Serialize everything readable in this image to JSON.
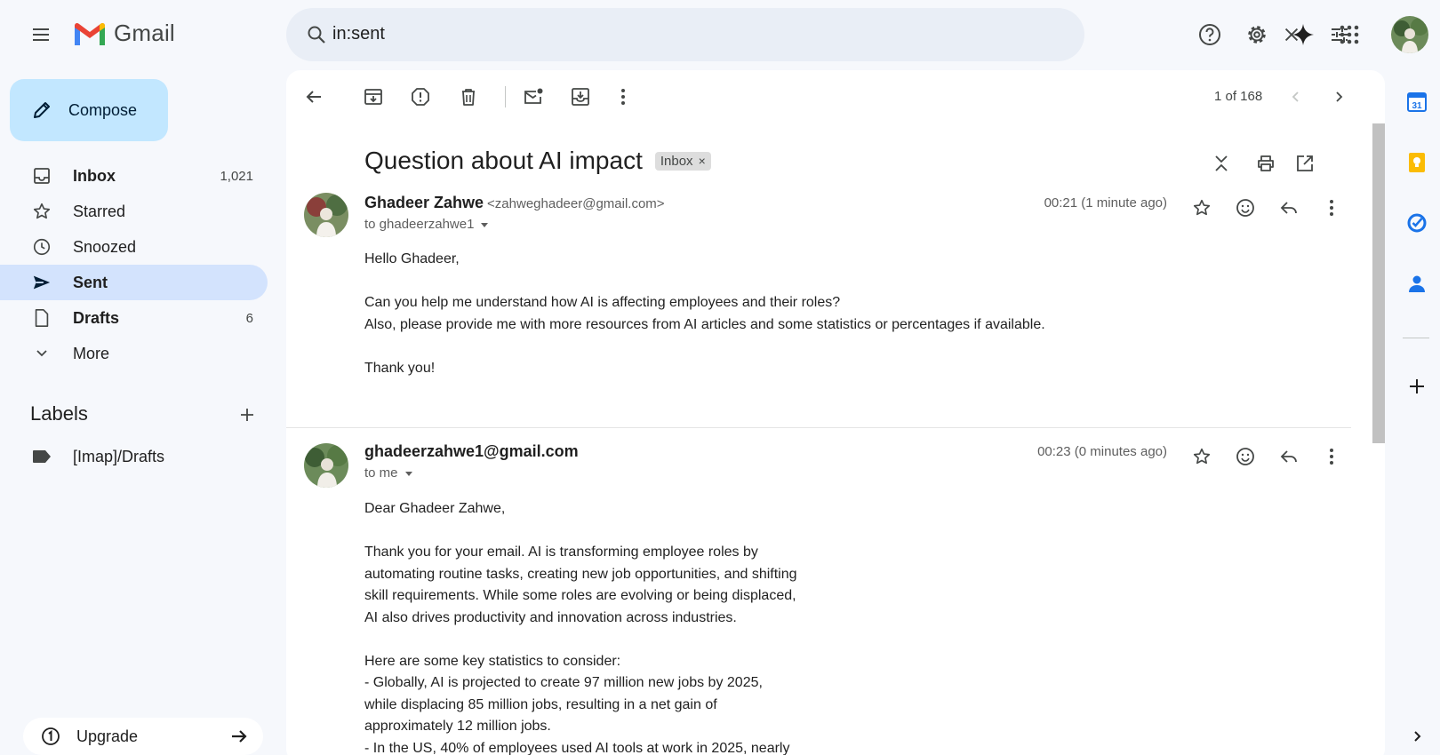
{
  "app": {
    "name": "Gmail"
  },
  "search": {
    "query": "in:sent"
  },
  "compose": {
    "label": "Compose"
  },
  "nav": [
    {
      "label": "Inbox",
      "count": "1,021"
    },
    {
      "label": "Starred",
      "count": ""
    },
    {
      "label": "Snoozed",
      "count": ""
    },
    {
      "label": "Sent",
      "count": ""
    },
    {
      "label": "Drafts",
      "count": "6"
    },
    {
      "label": "More",
      "count": ""
    }
  ],
  "labels": {
    "heading": "Labels",
    "items": [
      "[Imap]/Drafts"
    ]
  },
  "upgrade": {
    "label": "Upgrade"
  },
  "toolbar": {
    "pager": "1 of 168"
  },
  "thread": {
    "subject": "Question about AI impact",
    "chip": "Inbox",
    "chip_close": "×"
  },
  "messages": [
    {
      "sender_name": "Ghadeer Zahwe",
      "sender_email": "<zahweghadeer@gmail.com>",
      "to": "to ghadeerzahwe1",
      "time": "00:21 (1 minute ago)",
      "body": "  Hello Ghadeer,\n\nCan you help me understand how AI is affecting employees and their roles?\nAlso, please provide me with more resources from AI articles and some statistics or percentages if available.\n\nThank you!"
    },
    {
      "sender_name": "ghadeerzahwe1@gmail.com",
      "sender_email": "",
      "to": "to me",
      "time": "00:23 (0 minutes ago)",
      "body": "Dear Ghadeer Zahwe,\n\nThank you for your email. AI is transforming employee roles by\nautomating routine tasks, creating new job opportunities, and shifting\nskill requirements. While some roles are evolving or being displaced,\nAI also drives productivity and innovation across industries.\n\nHere are some key statistics to consider:\n- Globally, AI is projected to create 97 million new jobs by 2025,\nwhile displacing 85 million jobs, resulting in a net gain of\napproximately 12 million jobs.\n- In the US, 40% of employees used AI tools at work in 2025, nearly"
    }
  ],
  "colors": {
    "compose_bg": "#c2e7ff",
    "active_nav": "#d3e3fd",
    "search_bg": "#e9eef6",
    "page_bg": "#f6f8fc"
  },
  "rail_icons": [
    "calendar-icon",
    "keep-icon",
    "tasks-icon",
    "contacts-icon",
    "add-icon"
  ],
  "rail_calendar_day": "31"
}
